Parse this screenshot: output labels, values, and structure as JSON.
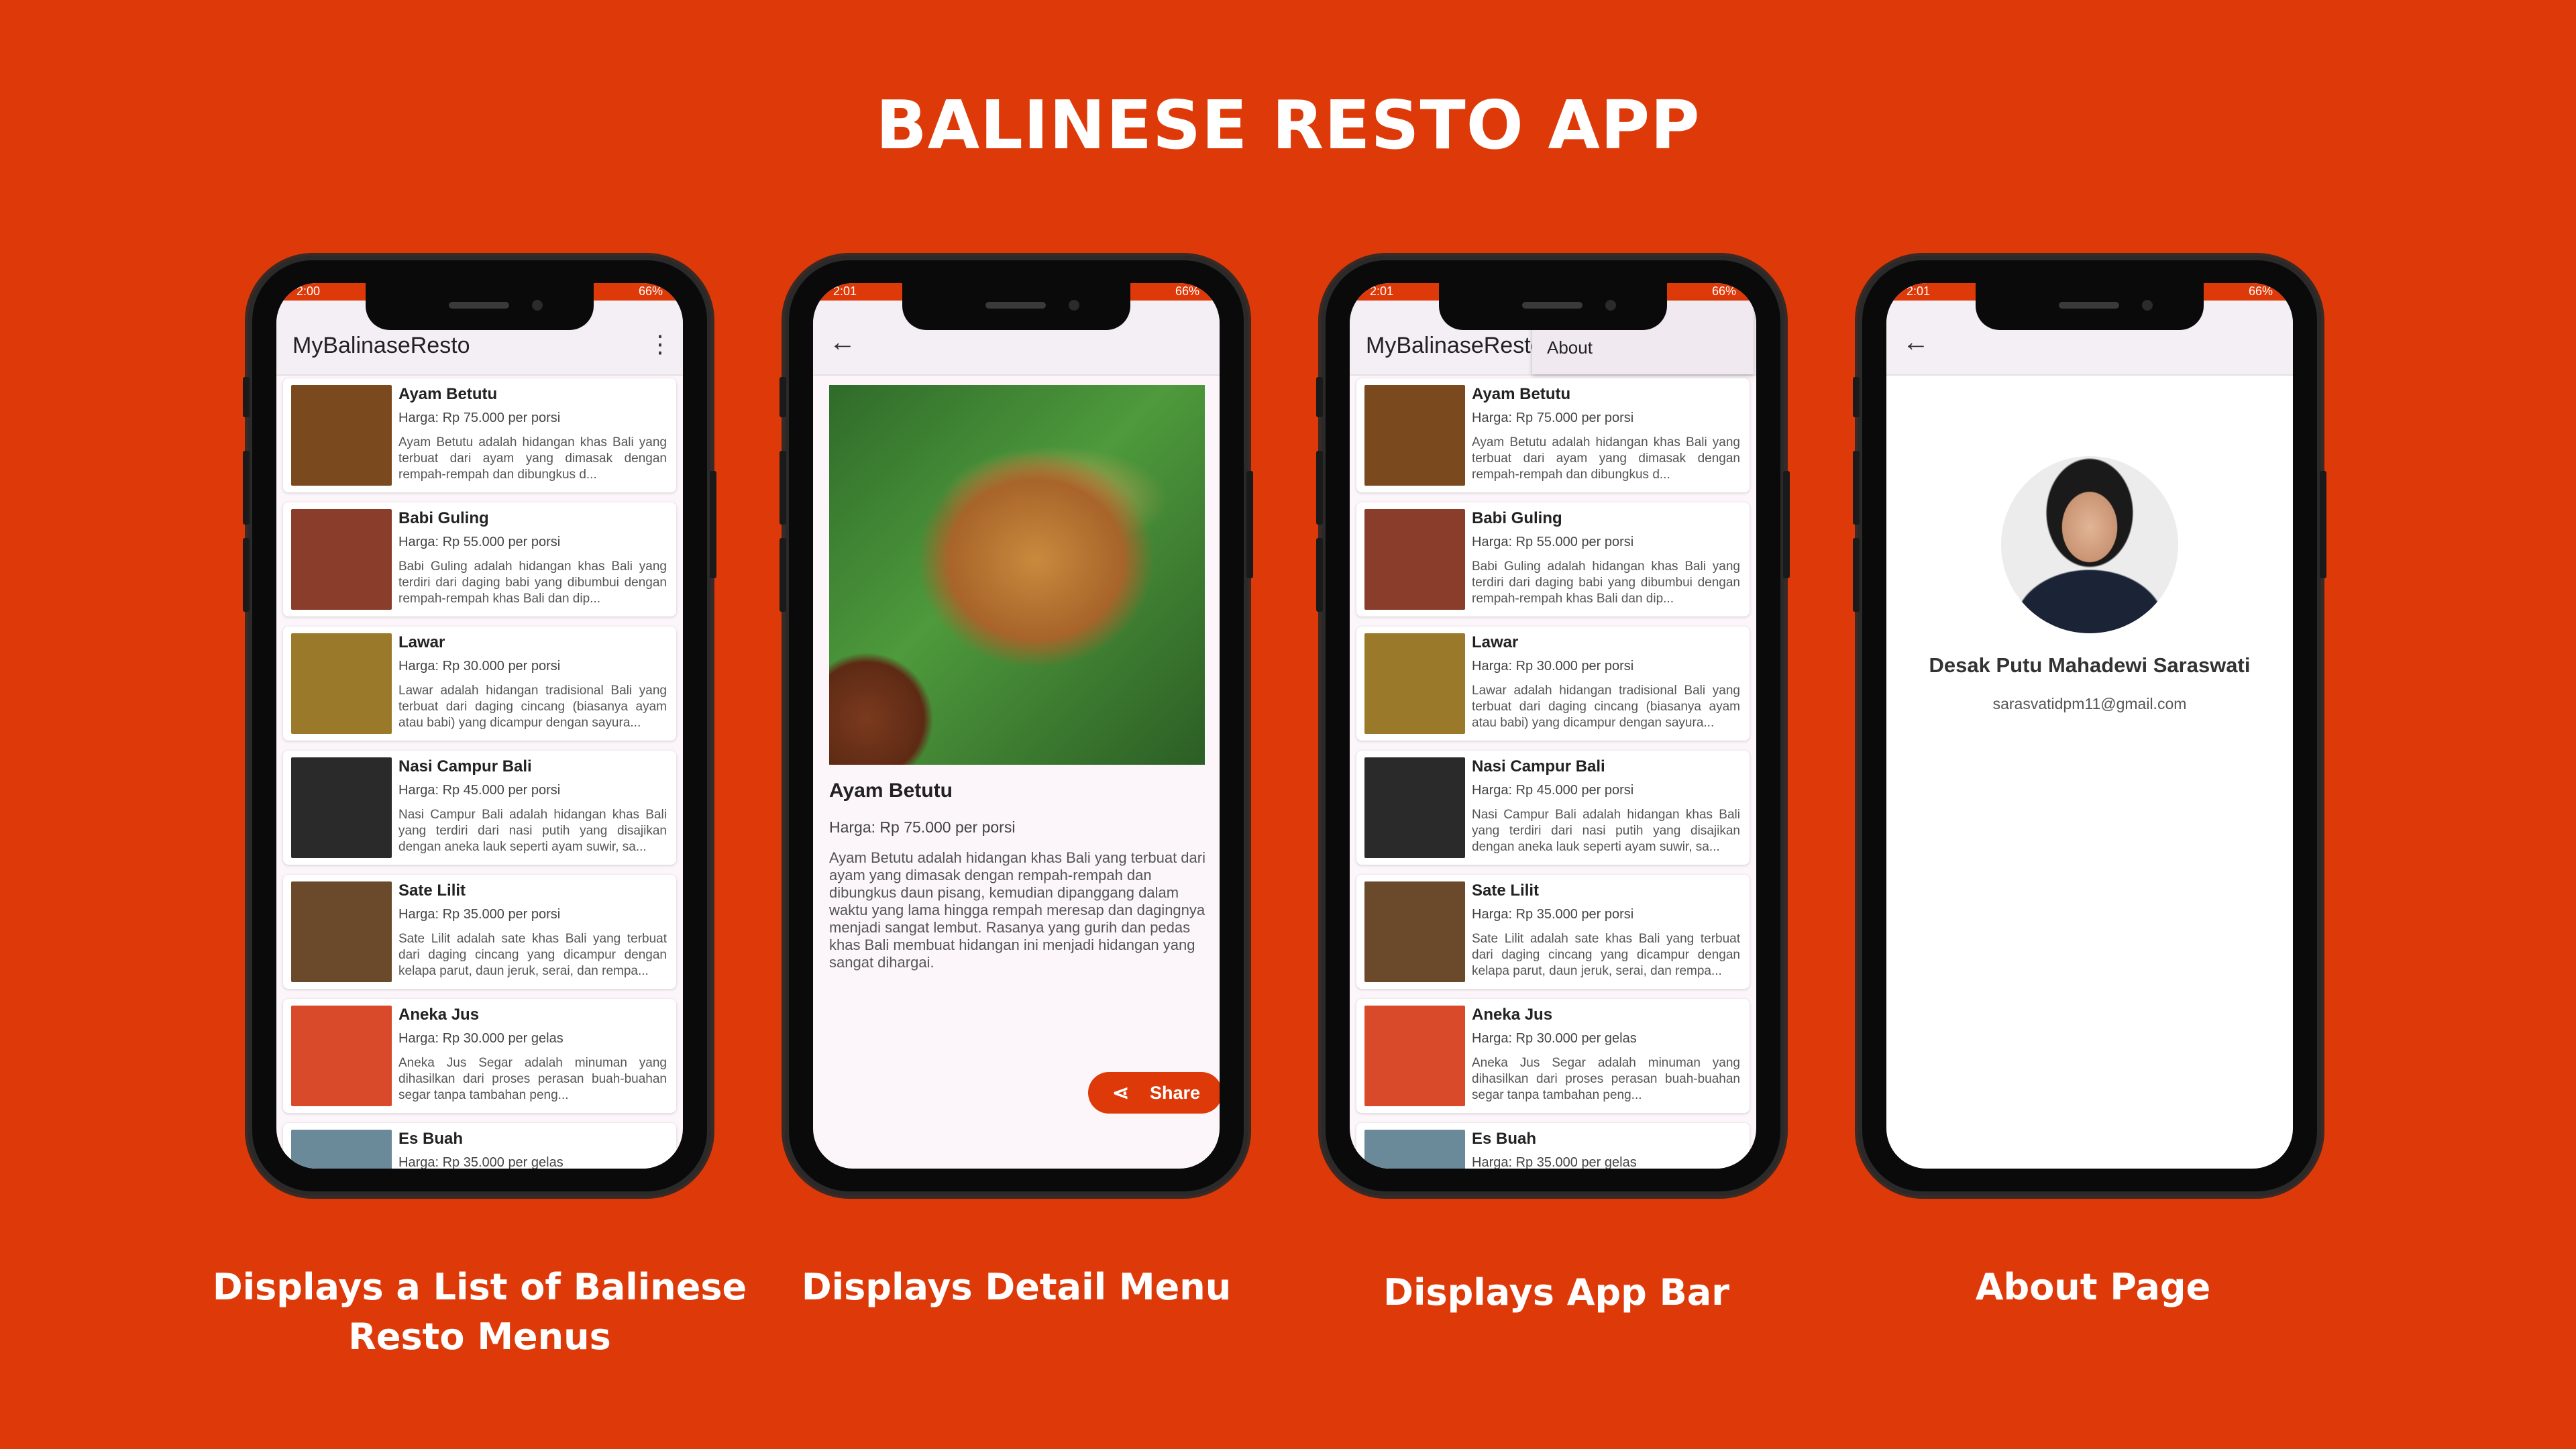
{
  "header": {
    "title": "BALINESE RESTO APP"
  },
  "status": {
    "battery": "66%",
    "time1": "2:00",
    "time2": "2:01"
  },
  "list_screen": {
    "app_title": "MyBalinaseResto"
  },
  "appbar_screen": {
    "app_title": "MyBalinaseResto",
    "menu_item": "About"
  },
  "menu": [
    {
      "name": "Ayam Betutu",
      "price": "Harga: Rp 75.000 per porsi",
      "desc": "Ayam Betutu adalah hidangan khas Bali yang terbuat dari ayam yang dimasak dengan rempah-rempah dan dibungkus d...",
      "img": "#7a4a1e"
    },
    {
      "name": "Babi Guling",
      "price": "Harga: Rp 55.000 per porsi",
      "desc": "Babi Guling adalah hidangan khas Bali yang terdiri dari daging babi yang dibumbui dengan rempah-rempah khas Bali dan dip...",
      "img": "#8a3d2a"
    },
    {
      "name": "Lawar",
      "price": "Harga: Rp 30.000 per porsi",
      "desc": "Lawar adalah hidangan tradisional Bali yang terbuat dari daging cincang (biasanya ayam atau babi) yang dicampur dengan sayura...",
      "img": "#9a7a2a"
    },
    {
      "name": "Nasi Campur Bali",
      "price": "Harga: Rp 45.000 per porsi",
      "desc": "Nasi Campur Bali adalah hidangan khas Bali yang terdiri dari nasi putih yang disajikan dengan aneka lauk seperti ayam suwir, sa...",
      "img": "#2a2a2a"
    },
    {
      "name": "Sate Lilit",
      "price": "Harga: Rp 35.000 per porsi",
      "desc": "Sate Lilit adalah sate khas Bali yang terbuat dari daging cincang yang dicampur dengan kelapa parut, daun jeruk, serai, dan rempa...",
      "img": "#6a4a2a"
    },
    {
      "name": "Aneka Jus",
      "price": "Harga: Rp 30.000 per gelas",
      "desc": "Aneka Jus Segar adalah minuman yang dihasilkan dari proses perasan buah-buahan segar tanpa tambahan peng...",
      "img": "#d94a2a"
    },
    {
      "name": "Es Buah",
      "price": "Harga: Rp 35.000 per gelas",
      "desc": "",
      "img": "#6a8a9a"
    }
  ],
  "detail": {
    "name": "Ayam Betutu",
    "price": "Harga: Rp 75.000 per porsi",
    "desc": "Ayam Betutu adalah hidangan khas Bali yang terbuat dari ayam yang dimasak dengan rempah-rempah dan dibungkus daun pisang, kemudian dipanggang dalam waktu yang lama hingga rempah meresap dan dagingnya menjadi sangat lembut. Rasanya yang gurih dan pedas khas Bali membuat hidangan ini menjadi hidangan yang sangat dihargai.",
    "share_label": "Share"
  },
  "about": {
    "name": "Desak Putu Mahadewi Saraswati",
    "email": "sarasvatidpm11@gmail.com"
  },
  "captions": {
    "list": "Displays a List of Balinese Resto Menus",
    "detail": "Displays Detail Menu",
    "appbar": "Displays App Bar",
    "about": "About Page"
  }
}
